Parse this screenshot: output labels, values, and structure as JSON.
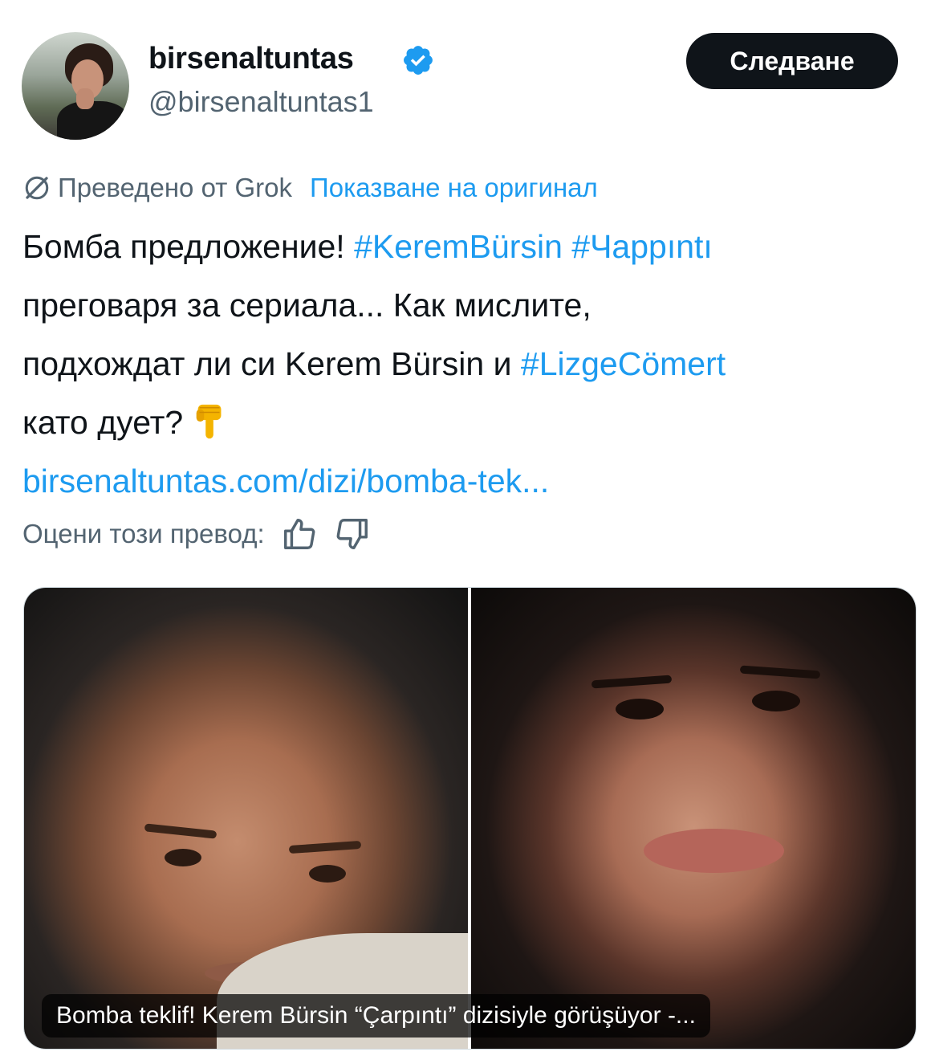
{
  "author": {
    "display_name": "birsenaltuntas",
    "handle": "@birsenaltuntas1",
    "verified": true,
    "avatar_icon": "profile-photo"
  },
  "follow_button": {
    "label": "Следване"
  },
  "translation": {
    "label": "Преведено от Grok",
    "show_original": "Показване на оригинал",
    "icon": "grok-icon"
  },
  "tweet": {
    "line1_text": "Бомба предложение! ",
    "hashtag1": "#KeremBürsin",
    "hashtag2": "#Чарpıntı",
    "line2": "преговаря за сериала... Как мислите,",
    "line3_text": "подхождат ли си Kerem Bürsin и ",
    "hashtag3": "#LizgeCömert",
    "line4_text": "като дует?",
    "emoji": "backhand-index-pointing-down",
    "link": "birsenaltuntas.com/dizi/bomba-tek..."
  },
  "rate_translation": {
    "label": "Оцени този превод:",
    "like_icon": "thumbs-up-icon",
    "dislike_icon": "thumbs-down-icon"
  },
  "link_card": {
    "caption": "Bomba teklif! Kerem Bürsin “Çarpıntı” dizisiyle görüşüyor -..."
  },
  "colors": {
    "accent": "#1d9bf0",
    "text_primary": "#0f1419",
    "text_secondary": "#536471",
    "button_bg": "#0f1419"
  }
}
